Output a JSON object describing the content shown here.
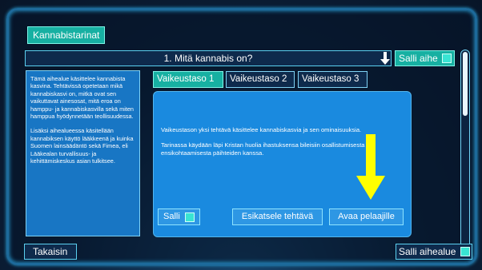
{
  "header": {
    "tab_label": "Kannabistarinat"
  },
  "topic": {
    "title": "1. Mitä kannabis on?",
    "allow_label": "Salli aihe"
  },
  "side_text": [
    "Tämä aihealue käsittelee kannabista kasvina. Tehtävissä opetetaan mikä kannabiskasvi on, mitkä ovat sen vaikuttavat ainesosat, mitä eroa on hamppu- ja kannabiskasvilla sekä miten hamppua hyödynnetään teollisuudessa.",
    "Lisäksi aihealueessa käsitellään kannabiksen käyttö lääkkeenä ja kuinka Suomen lainsäädäntö sekä Fimea, eli Lääkealan turvallisuus- ja kehittämiskeskus asian tulkitsee."
  ],
  "levels": [
    {
      "label": "Vaikeustaso 1",
      "active": true
    },
    {
      "label": "Vaikeustaso 2",
      "active": false
    },
    {
      "label": "Vaikeustaso 3",
      "active": false
    }
  ],
  "level_desc": [
    "Vaikeustason yksi tehtävä käsittelee kannabiskasvia ja sen ominaisuuksia.",
    "Tarinassa käydään läpi Kristan huolia ihastuksensa bileisiin osallistumisesta ja ensikohtaamisesta päihteiden kanssa."
  ],
  "actions": {
    "allow": "Salli",
    "preview": "Esikatsele tehtävä",
    "open": "Avaa pelaajille"
  },
  "footer": {
    "back": "Takaisin",
    "allow_area": "Salli aihealue"
  },
  "colors": {
    "accent": "#17b0a2",
    "card": "#1a8adf",
    "arrow": "#ffff00"
  }
}
